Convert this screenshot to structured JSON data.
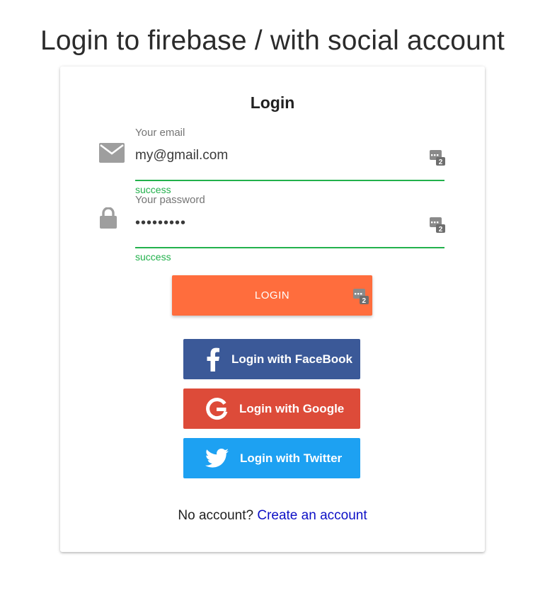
{
  "page": {
    "title": "Login to firebase / with social account"
  },
  "form": {
    "title": "Login",
    "email": {
      "label": "Your email",
      "value": "my@gmail.com",
      "status": "success"
    },
    "password": {
      "label": "Your password",
      "value": "•••••••••",
      "status": "success"
    },
    "login_button": "LOGIN"
  },
  "social": {
    "facebook": "Login with FaceBook",
    "google": "Login with Google",
    "twitter": "Login with Twitter"
  },
  "footer": {
    "text": "No account?",
    "link": "Create an account"
  },
  "icons": {
    "email": "envelope-icon",
    "password": "lock-icon",
    "password_manager": "password-manager-icon",
    "facebook": "facebook-icon",
    "google": "google-icon",
    "twitter": "twitter-icon"
  },
  "colors": {
    "success": "#22b14c",
    "login_button": "#ff6d3d",
    "facebook": "#3b5998",
    "google": "#dd4b39",
    "twitter": "#1da1f2",
    "link": "#0d10c6"
  }
}
